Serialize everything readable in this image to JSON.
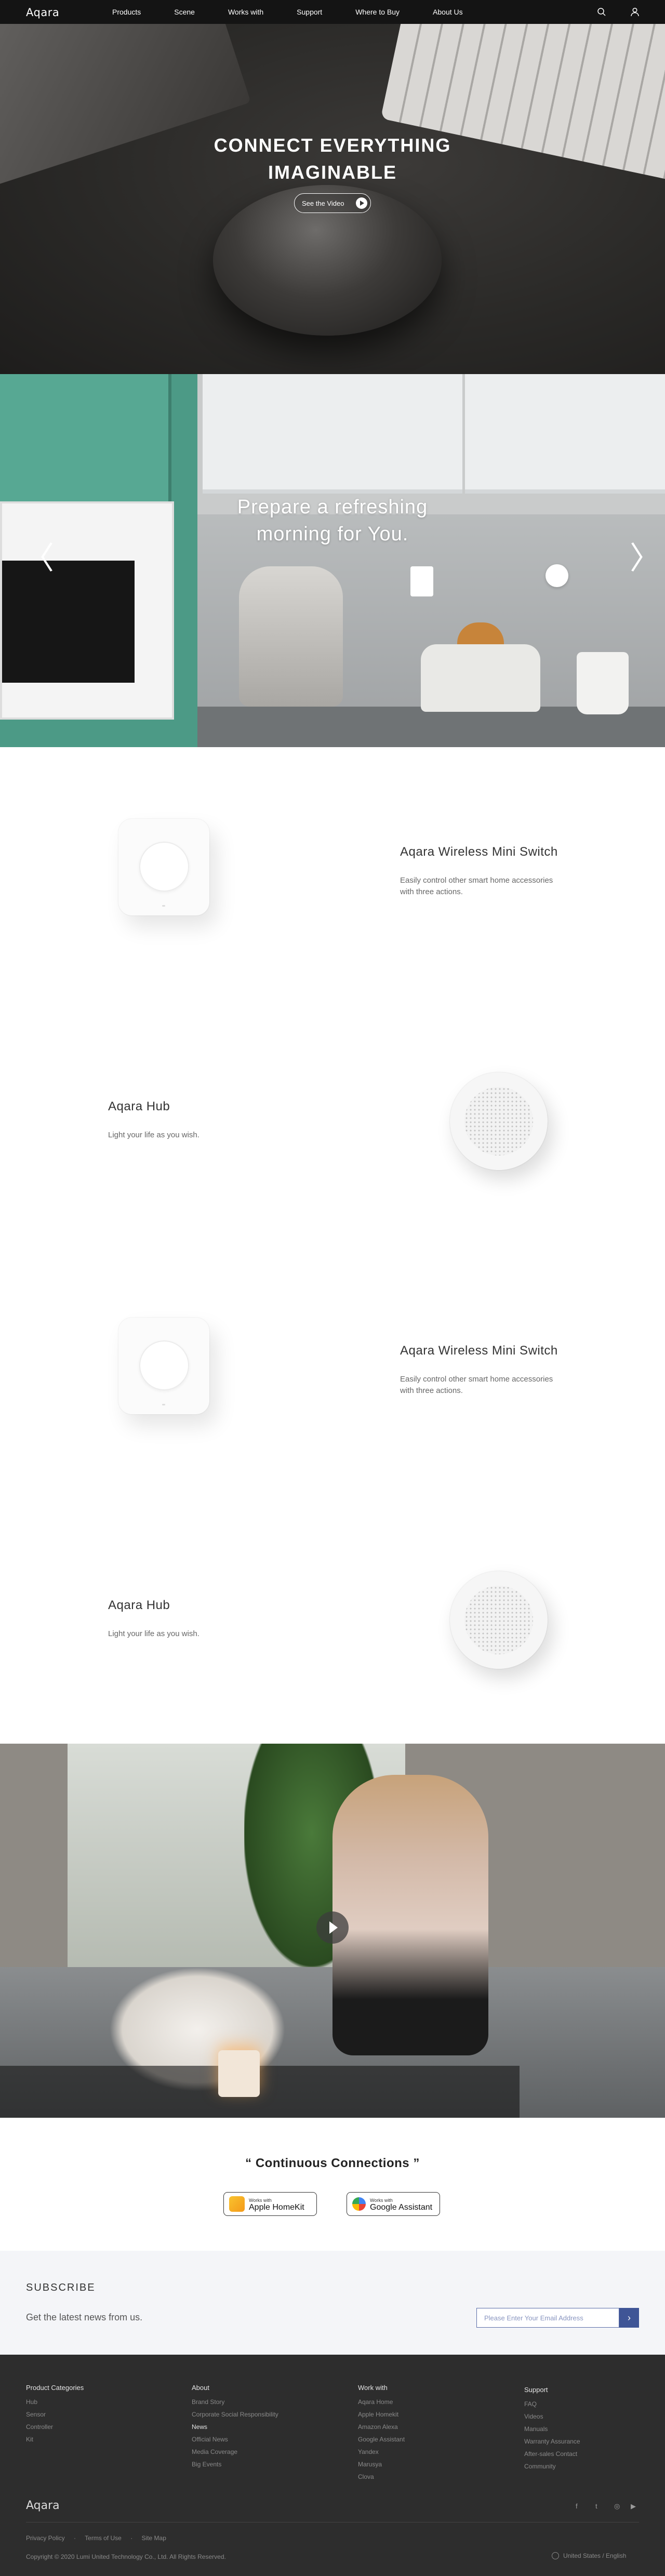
{
  "nav": {
    "logo": "Aqara",
    "items": [
      "Products",
      "Scene",
      "Works with",
      "Support",
      "Where to Buy",
      "About Us"
    ]
  },
  "hero": {
    "title_line1": "CONNECT EVERYTHING",
    "title_line2": "IMAGINABLE",
    "cta": "See the Video"
  },
  "carousel": {
    "title_line1": "Prepare a refreshing",
    "title_line2": "morning for You.",
    "prev": "〈",
    "next": "〉"
  },
  "products": [
    {
      "title": "Aqara Wireless Mini Switch",
      "desc_line1": "Easily control other smart home accessories",
      "desc_line2": "with three actions."
    },
    {
      "title": "Aqara Hub",
      "desc_line1": "Light your life as you wish.",
      "desc_line2": ""
    },
    {
      "title": "Aqara Wireless Mini Switch",
      "desc_line1": "Easily control other smart home accessories",
      "desc_line2": "with three actions."
    },
    {
      "title": "Aqara Hub",
      "desc_line1": "Light your life as you wish.",
      "desc_line2": ""
    }
  ],
  "connections": {
    "title": "“ Continuous Connections ”",
    "homekit_small": "Works with",
    "homekit_large": "Apple HomeKit",
    "google_small": "Works with",
    "google_large": "Google Assistant"
  },
  "subscribe": {
    "title": "SUBSCRIBE",
    "desc": "Get the latest news from us.",
    "placeholder": "Please Enter Your Email Address",
    "button": "›"
  },
  "footer": {
    "col1": {
      "heading": "Product Categories",
      "items": [
        "Hub",
        "Sensor",
        "Controller",
        "Kit"
      ]
    },
    "col2": {
      "heading": "About",
      "items": [
        "Brand Story",
        "Corporate Social Responsibility",
        "News",
        "Official News",
        "Media Coverage",
        "Big Events"
      ]
    },
    "col3": {
      "heading": "Work with",
      "items": [
        "Aqara Home",
        "Apple Homekit",
        "Amazon Alexa",
        "Google Assistant",
        "Yandex",
        "Marusya",
        "Clova"
      ]
    },
    "col4": {
      "heading": "Support",
      "items": [
        "FAQ",
        "Videos",
        "Manuals",
        "Warranty Assurance",
        "After-sales Contact",
        "Community"
      ]
    },
    "logo": "Aqara",
    "social": [
      "f",
      "t",
      "◎",
      "▶"
    ],
    "legal": [
      "Privacy Policy",
      "·",
      "Terms of Use",
      "·",
      "Site Map"
    ],
    "copyright": "Copyright © 2020 Lumi United Technology Co., Ltd. All Rights Reserved.",
    "region": "United States / English"
  },
  "colors": {
    "nav_bg": "#141414",
    "accent": "#3f5596",
    "footer_bg": "#2d2d2d"
  }
}
